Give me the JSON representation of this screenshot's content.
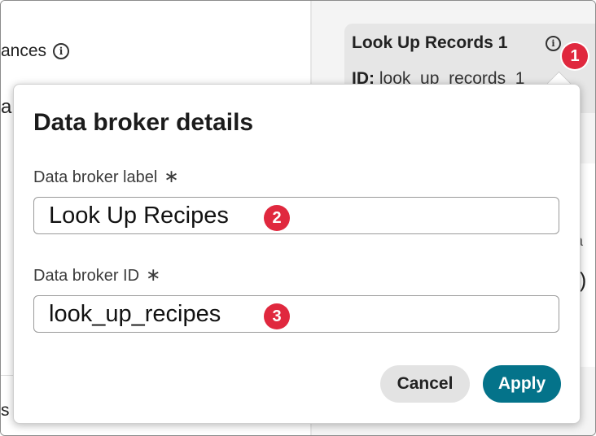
{
  "background": {
    "left_heading": "ances",
    "left_peek_text": "a",
    "left_bottom_peek": "s",
    "card": {
      "title": "Look Up Records 1",
      "id_label": "ID:",
      "id_value": "look_up_records_1"
    },
    "right_peek_a": "a",
    "right_peek_r": "r)"
  },
  "dialog": {
    "title": "Data broker details",
    "label_field": {
      "label": "Data broker label",
      "required_mark": "∗",
      "value": "Look Up Recipes"
    },
    "id_field": {
      "label": "Data broker ID",
      "required_mark": "∗",
      "value": "look_up_recipes"
    },
    "buttons": {
      "cancel": "Cancel",
      "apply": "Apply"
    }
  },
  "callouts": [
    "1",
    "2",
    "3"
  ],
  "icons": {
    "info": "info-icon"
  },
  "colors": {
    "apply": "#04738a",
    "callout": "#e0283e"
  }
}
